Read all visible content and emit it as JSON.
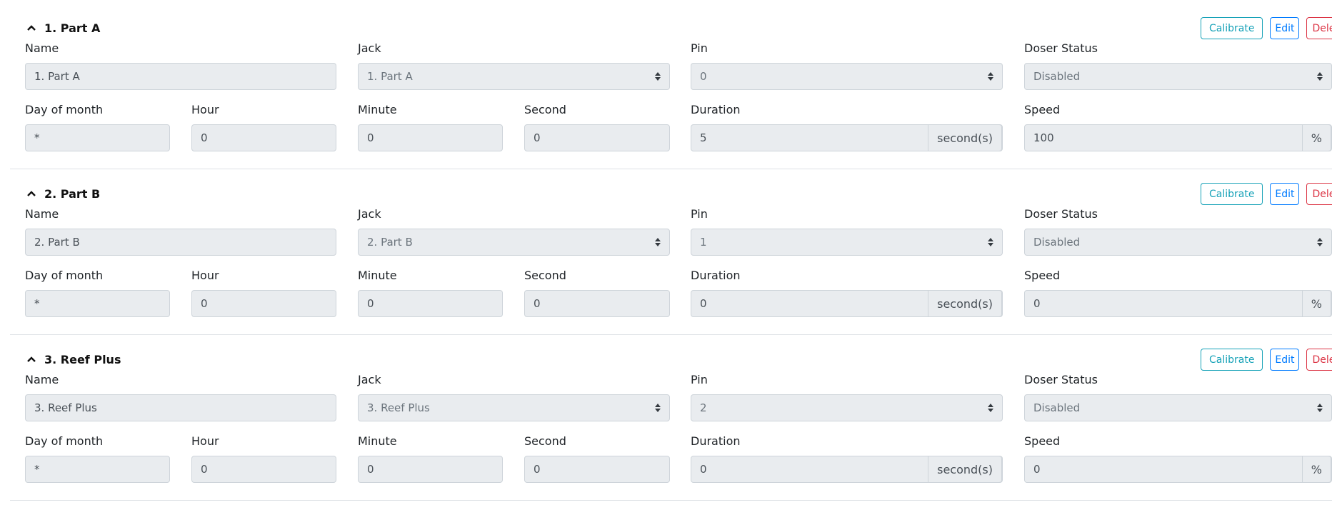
{
  "buttons": {
    "calibrate": "Calibrate",
    "edit": "Edit",
    "delete": "Delete"
  },
  "labels": {
    "name": "Name",
    "jack": "Jack",
    "pin": "Pin",
    "doser_status": "Doser Status",
    "day_of_month": "Day of month",
    "hour": "Hour",
    "minute": "Minute",
    "second": "Second",
    "duration": "Duration",
    "speed": "Speed"
  },
  "units": {
    "duration": "second(s)",
    "speed": "%"
  },
  "dosers": [
    {
      "title": "1. Part A",
      "name": "1. Part A",
      "jack": "1. Part A",
      "pin": "0",
      "status": "Disabled",
      "day_of_month": "*",
      "hour": "0",
      "minute": "0",
      "second": "0",
      "duration": "5",
      "speed": "100"
    },
    {
      "title": "2. Part B",
      "name": "2. Part B",
      "jack": "2. Part B",
      "pin": "1",
      "status": "Disabled",
      "day_of_month": "*",
      "hour": "0",
      "minute": "0",
      "second": "0",
      "duration": "0",
      "speed": "0"
    },
    {
      "title": "3. Reef Plus",
      "name": "3. Reef Plus",
      "jack": "3. Reef Plus",
      "pin": "2",
      "status": "Disabled",
      "day_of_month": "*",
      "hour": "0",
      "minute": "0",
      "second": "0",
      "duration": "0",
      "speed": "0"
    }
  ]
}
